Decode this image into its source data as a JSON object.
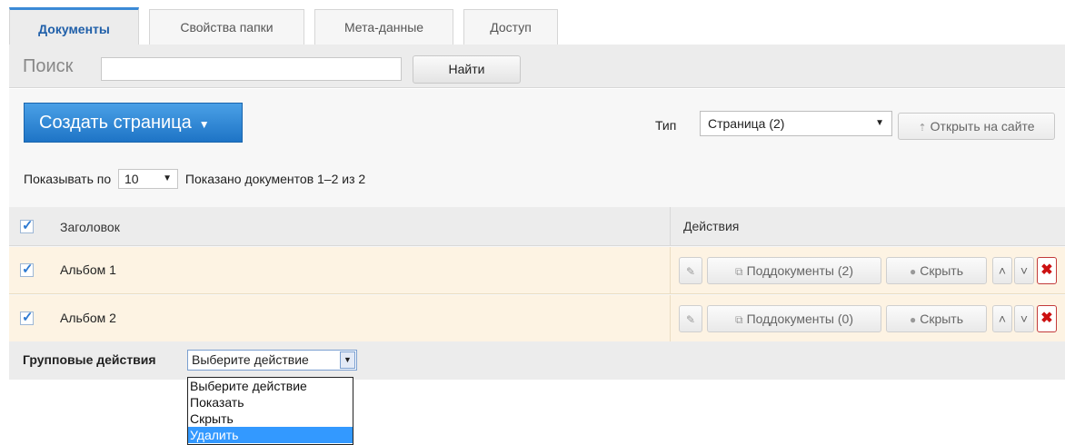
{
  "tabs": [
    {
      "label": "Документы",
      "active": true
    },
    {
      "label": "Свойства папки",
      "active": false
    },
    {
      "label": "Мета-данные",
      "active": false
    },
    {
      "label": "Доступ",
      "active": false
    }
  ],
  "search": {
    "label": "Поиск",
    "value": "",
    "placeholder": "",
    "button_label": "Найти"
  },
  "toolbar": {
    "create_label": "Создать страница",
    "type_label": "Тип",
    "type_value": "Страница (2)",
    "open_site_label": "Открыть на сайте"
  },
  "pagination": {
    "per_page_label": "Показывать по",
    "per_page_value": "10",
    "shown_text": "Показано документов 1–2 из 2"
  },
  "table": {
    "columns": [
      "Заголовок",
      "Действия"
    ],
    "header_checked": true,
    "rows": [
      {
        "title": "Альбом 1",
        "checked": true,
        "subdocs_label": "Поддокументы (2)",
        "hide_label": "Скрыть"
      },
      {
        "title": "Альбом 2",
        "checked": true,
        "subdocs_label": "Поддокументы (0)",
        "hide_label": "Скрыть"
      }
    ]
  },
  "group_actions": {
    "label": "Групповые действия",
    "selected": "Выберите действие",
    "options": [
      "Выберите действие",
      "Показать",
      "Скрыть",
      "Удалить"
    ],
    "highlighted_option": "Удалить"
  },
  "icons": {
    "edit": "pencil-icon",
    "subdocs": "copy-icon",
    "hide": "dot-icon",
    "move_up": "chevron-up-icon",
    "move_down": "chevron-down-icon",
    "delete": "close-icon",
    "open_site": "external-link-icon"
  },
  "colors": {
    "accent": "#1e74c6",
    "row_background": "#fdf3e3",
    "delete": "#c11111",
    "highlight": "#3399ff"
  }
}
